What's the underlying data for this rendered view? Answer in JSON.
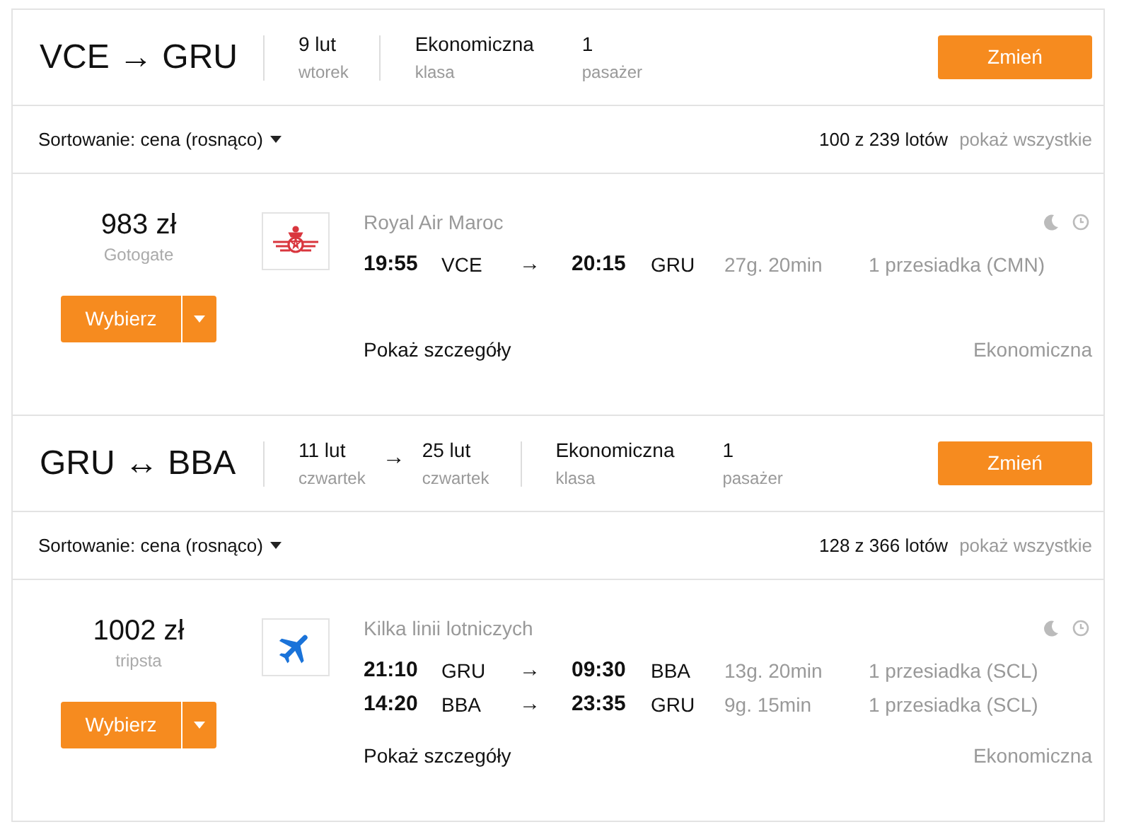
{
  "searches": [
    {
      "route": {
        "from": "VCE",
        "arrow": "→",
        "to": "GRU"
      },
      "dates": [
        {
          "date": "9 lut",
          "day": "wtorek"
        }
      ],
      "cabin": {
        "value": "Ekonomiczna",
        "label": "klasa"
      },
      "passengers": {
        "value": "1",
        "label": "pasażer"
      },
      "change_button": "Zmień",
      "sort": "Sortowanie: cena (rosnąco)",
      "count": "100 z 239 lotów",
      "show_all": "pokaż wszystkie",
      "result": {
        "price": "983 zł",
        "provider": "Gotogate",
        "select_button": "Wybierz",
        "logo": {
          "kind": "crest"
        },
        "airline": "Royal Air Maroc",
        "legs": [
          {
            "dep_time": "19:55",
            "dep_airport": "VCE",
            "arrow": "→",
            "arr_time": "20:15",
            "arr_airport": "GRU",
            "duration": "27g. 20min",
            "stops": "1 przesiadka (CMN)"
          }
        ],
        "details_link": "Pokaż szczegóły",
        "cabin": "Ekonomiczna"
      }
    },
    {
      "route": {
        "from": "GRU",
        "arrow": "↔",
        "to": "BBA"
      },
      "dates": [
        {
          "date": "11 lut",
          "day": "czwartek"
        },
        {
          "date": "25 lut",
          "day": "czwartek"
        }
      ],
      "date_arrow": "→",
      "cabin": {
        "value": "Ekonomiczna",
        "label": "klasa"
      },
      "passengers": {
        "value": "1",
        "label": "pasażer"
      },
      "change_button": "Zmień",
      "sort": "Sortowanie: cena (rosnąco)",
      "count": "128 z 366 lotów",
      "show_all": "pokaż wszystkie",
      "result": {
        "price": "1002 zł",
        "provider": "tripsta",
        "select_button": "Wybierz",
        "logo": {
          "kind": "plane"
        },
        "airline": "Kilka linii lotniczych",
        "legs": [
          {
            "dep_time": "21:10",
            "dep_airport": "GRU",
            "arrow": "→",
            "arr_time": "09:30",
            "arr_airport": "BBA",
            "duration": "13g. 20min",
            "stops": "1 przesiadka (SCL)"
          },
          {
            "dep_time": "14:20",
            "dep_airport": "BBA",
            "arrow": "→",
            "arr_time": "23:35",
            "arr_airport": "GRU",
            "duration": "9g. 15min",
            "stops": "1 przesiadka (SCL)"
          }
        ],
        "details_link": "Pokaż szczegóły",
        "cabin": "Ekonomiczna"
      }
    }
  ]
}
